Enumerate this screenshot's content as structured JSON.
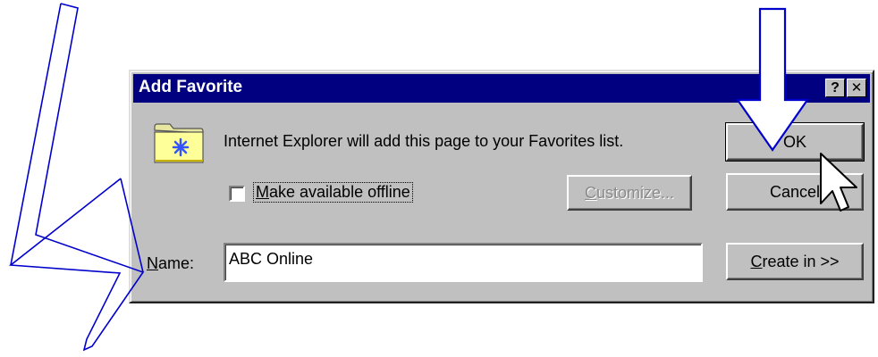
{
  "dialog": {
    "title": "Add Favorite",
    "help_label": "?",
    "close_label": "✕",
    "message": "Internet Explorer will add this page to your Favorites list.",
    "offline_label_accel": "M",
    "offline_label_rest": "ake available offline",
    "offline_checked": false,
    "customize_accel": "C",
    "customize_rest": "ustomize...",
    "ok_label": "OK",
    "cancel_label": "Cancel",
    "name_label_accel": "N",
    "name_label_rest": "ame:",
    "name_value": "ABC Online",
    "create_in_accel": "C",
    "create_in_rest": "reate in >>"
  },
  "icons": {
    "folder": "favorites-folder-icon",
    "cursor": "mouse-pointer-icon",
    "annotations": [
      "arrow-down-icon",
      "zigzag-arrow-icon"
    ]
  },
  "colors": {
    "titlebar": "#000080",
    "dialog_face": "#c0c0c0",
    "folder": "#ffff99",
    "star": "#3355ff"
  }
}
